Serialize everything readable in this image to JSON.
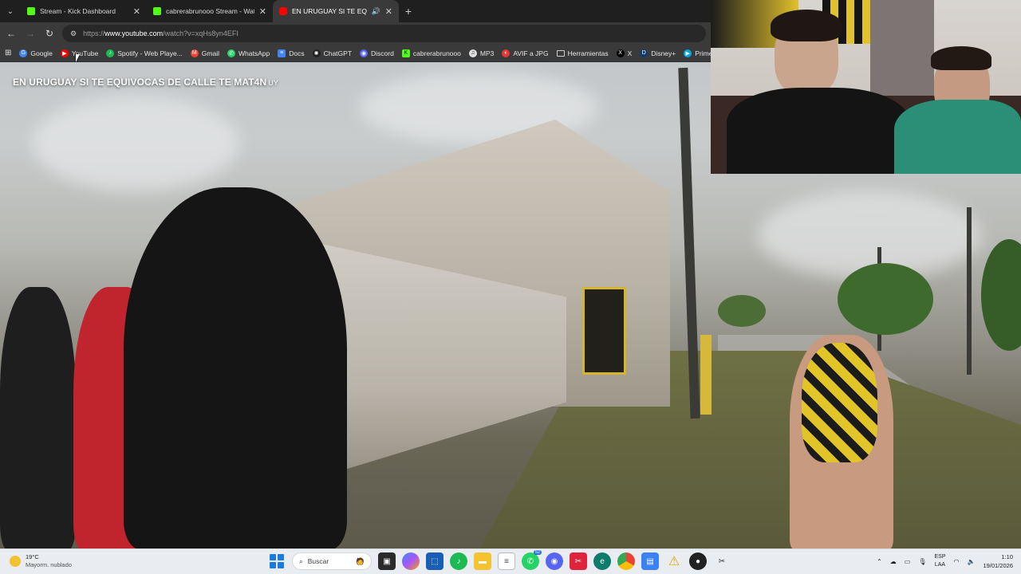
{
  "browser": {
    "tabs": [
      {
        "title": "Stream - Kick Dashboard",
        "favicon_color": "#53fc18",
        "active": false
      },
      {
        "title": "cabrerabrunooo Stream - Watch",
        "favicon_color": "#53fc18",
        "active": false
      },
      {
        "title": "EN URUGUAY SI TE EQUIVOCAS",
        "favicon_color": "#ff0000",
        "active": true
      }
    ],
    "url_prefix": "https://",
    "url_host": "www.youtube.com",
    "url_path": "/watch?v=xqHs8yn4EFI",
    "bookmarks": [
      {
        "label": "Google",
        "color": "#4285f4",
        "glyph": "G"
      },
      {
        "label": "YouTube",
        "color": "#ff0000",
        "glyph": "▶"
      },
      {
        "label": "Spotify - Web Playe...",
        "color": "#1db954",
        "glyph": "♪"
      },
      {
        "label": "Gmail",
        "color": "#ea4335",
        "glyph": "M"
      },
      {
        "label": "WhatsApp",
        "color": "#25d366",
        "glyph": "✆"
      },
      {
        "label": "Docs",
        "color": "#4285f4",
        "glyph": "≡"
      },
      {
        "label": "ChatGPT",
        "color": "#202020",
        "glyph": "✺"
      },
      {
        "label": "Discord",
        "color": "#5865f2",
        "glyph": "◉"
      },
      {
        "label": "cabrerabrunooo",
        "color": "#53fc18",
        "glyph": "K"
      },
      {
        "label": "MP3",
        "color": "#e0e0e0",
        "glyph": "♫"
      },
      {
        "label": "AVIF a JPG",
        "color": "#e53935",
        "glyph": "◐"
      },
      {
        "label": "Herramientas",
        "color": "#3a3a3a",
        "glyph": "▭"
      },
      {
        "label": "X",
        "color": "#000000",
        "glyph": "X"
      },
      {
        "label": "Disney+",
        "color": "#0e3a6e",
        "glyph": "D"
      },
      {
        "label": "Prime",
        "color": "#00a8e1",
        "glyph": "▶"
      }
    ]
  },
  "video": {
    "title": "EN URUGUAY SI TE EQUIVOCAS DE CALLE TE MAT4N",
    "title_suffix": "UY"
  },
  "taskbar": {
    "weather_temp": "19°C",
    "weather_desc": "Mayorm. nublado",
    "search_placeholder": "Buscar",
    "whatsapp_badge": "52",
    "lang_top": "ESP",
    "lang_bottom": "LAA",
    "time": "1:10",
    "date": "19/01/2026"
  }
}
